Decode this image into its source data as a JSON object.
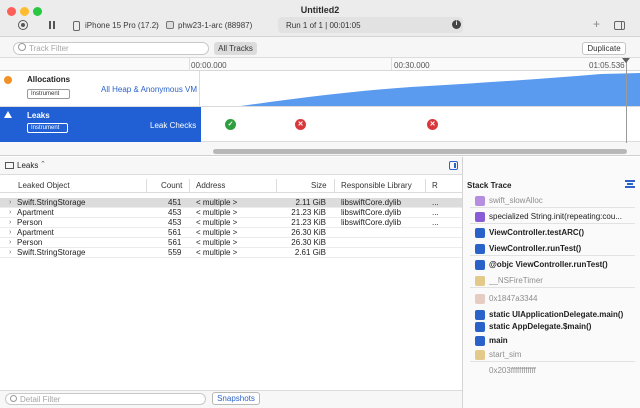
{
  "window": {
    "title": "Untitled2",
    "device": "iPhone 15 Pro (17.2)",
    "process": "phw23-1-arc (88987)",
    "run_status": "Run 1 of 1  |  00:01:05"
  },
  "toolbar": {
    "track_filter_placeholder": "Track Filter",
    "all_tracks_label": "All Tracks",
    "duplicate_label": "Duplicate"
  },
  "timeline": {
    "ticks": [
      "00:00.000",
      "00:30.000",
      "01:05.536"
    ],
    "tracks": [
      {
        "name": "Allocations",
        "instrument_label": "Instrument",
        "detail": "All Heap & Anonymous VM",
        "icon_color": "#f29226"
      },
      {
        "name": "Leaks",
        "instrument_label": "Instrument",
        "detail": "Leak Checks",
        "selected": true
      }
    ],
    "leak_checks": [
      "ok",
      "leak",
      "leak"
    ]
  },
  "detail": {
    "mode_label": "Leaks",
    "columns": [
      "Leaked Object",
      "Count",
      "Address",
      "Size",
      "Responsible Library",
      "R"
    ],
    "rows": [
      {
        "object": "Swift.StringStorage",
        "count": "451",
        "address": "< multiple >",
        "size": "2.11 GiB",
        "library": "libswiftCore.dylib",
        "r": "...",
        "selected": true
      },
      {
        "object": "Apartment",
        "count": "453",
        "address": "< multiple >",
        "size": "21.23 KiB",
        "library": "libswiftCore.dylib",
        "r": "..."
      },
      {
        "object": "Person",
        "count": "453",
        "address": "< multiple >",
        "size": "21.23 KiB",
        "library": "libswiftCore.dylib",
        "r": "..."
      },
      {
        "object": "Apartment",
        "count": "561",
        "address": "< multiple >",
        "size": "26.30 KiB",
        "library": "",
        "r": ""
      },
      {
        "object": "Person",
        "count": "561",
        "address": "< multiple >",
        "size": "26.30 KiB",
        "library": "",
        "r": ""
      },
      {
        "object": "Swift.StringStorage",
        "count": "559",
        "address": "< multiple >",
        "size": "2.61 GiB",
        "library": "",
        "r": ""
      }
    ],
    "filter_placeholder": "Detail Filter",
    "snapshots_label": "Snapshots"
  },
  "stack_trace": {
    "title": "Stack Trace",
    "frames": [
      {
        "text": "swift_slowAlloc",
        "style": "gray",
        "icon_color": "#b58ee0"
      },
      {
        "text": "specialized String.init(repeating:cou...",
        "style": "dark",
        "icon_color": "#8a5bd6"
      },
      {
        "text": "ViewController.testARC()",
        "style": "bold",
        "icon_color": "#2a62c9"
      },
      {
        "text": "ViewController.runTest()",
        "style": "bold",
        "icon_color": "#2a62c9"
      },
      {
        "text": "@objc ViewController.runTest()",
        "style": "bold",
        "icon_color": "#2a62c9"
      },
      {
        "text": "__NSFireTimer",
        "style": "gray",
        "icon_color": "#e3c98a"
      },
      {
        "text": "0x1847a3344",
        "style": "gray",
        "icon_color": "#e6cdc3"
      },
      {
        "text": "static UIApplicationDelegate.main()",
        "style": "bold",
        "icon_color": "#2a62c9"
      },
      {
        "text": "static AppDelegate.$main()",
        "style": "bold",
        "icon_color": "#2a62c9"
      },
      {
        "text": "main",
        "style": "bold",
        "icon_color": "#2a62c9"
      },
      {
        "text": "start_sim",
        "style": "gray",
        "icon_color": "#e3c98a"
      },
      {
        "text": "0x203ffffffffffff",
        "style": "gray",
        "icon_color": ""
      }
    ]
  },
  "colors": {
    "accent": "#2060d4",
    "leak_ok": "#2e9e3e",
    "leak_bad": "#d9373b",
    "alloc_graph": "#5a9bf0"
  }
}
